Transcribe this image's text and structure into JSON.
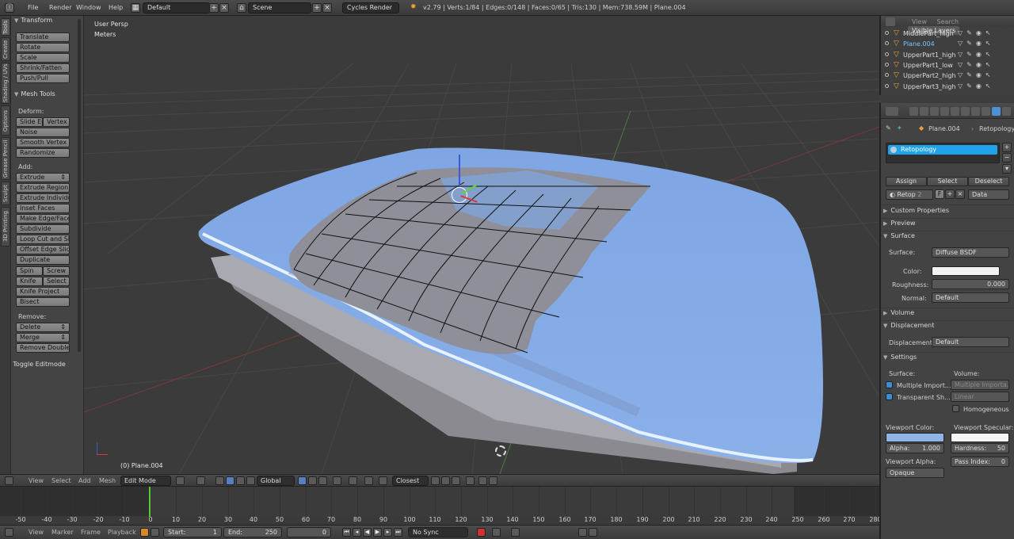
{
  "topbar": {
    "menus": [
      "File",
      "Render",
      "Window",
      "Help"
    ],
    "screen_layout": "Default",
    "scene": "Scene",
    "render_engine": "Cycles Render",
    "stats": "v2.79 | Verts:1/84 | Edges:0/148 | Faces:0/65 | Tris:130 | Mem:738.59M | Plane.004"
  },
  "vtabs": [
    "Tools",
    "Create",
    "Shading / UVs",
    "Options",
    "Grease Pencil",
    "Sculpt",
    "3D Printing"
  ],
  "toolshelf": {
    "transform_title": "Transform",
    "transform": [
      "Translate",
      "Rotate",
      "Scale",
      "Shrink/Fatten",
      "Push/Pull"
    ],
    "mesh_tools_title": "Mesh Tools",
    "deform_label": "Deform:",
    "slide_edge": "Slide Ed",
    "vertex": "Vertex",
    "deform": [
      "Noise",
      "Smooth Vertex",
      "Randomize"
    ],
    "add_label": "Add:",
    "extrude": "Extrude",
    "add": [
      "Extrude Region",
      "Extrude Individual",
      "Inset Faces",
      "Make Edge/Face",
      "Subdivide",
      "Loop Cut and Slide",
      "Offset Edge Slide",
      "Duplicate"
    ],
    "spin": "Spin",
    "screw": "Screw",
    "knife": "Knife",
    "select": "Select",
    "add2": [
      "Knife Project",
      "Bisect"
    ],
    "remove_label": "Remove:",
    "delete": "Delete",
    "merge": "Merge",
    "remove_doubles": "Remove Doubles",
    "toggle_editmode": "Toggle Editmode"
  },
  "viewport": {
    "persp": "User Persp",
    "units": "Meters",
    "object": "(0) Plane.004"
  },
  "vpheader": {
    "menus": [
      "View",
      "Select",
      "Add",
      "Mesh"
    ],
    "mode": "Edit Mode",
    "orientation": "Global",
    "snap": "Closest"
  },
  "timeline": {
    "ticks": [
      "-50",
      "-40",
      "-30",
      "-20",
      "-10",
      "0",
      "10",
      "20",
      "30",
      "40",
      "50",
      "60",
      "70",
      "80",
      "90",
      "100",
      "110",
      "120",
      "130",
      "140",
      "150",
      "160",
      "170",
      "180",
      "190",
      "200",
      "210",
      "220",
      "230",
      "240",
      "250",
      "260",
      "270",
      "280"
    ],
    "current_frame": 0
  },
  "tlheader": {
    "menus": [
      "View",
      "Marker",
      "Frame",
      "Playback"
    ],
    "start_label": "Start:",
    "start": "1",
    "end_label": "End:",
    "end": "250",
    "frame": "0",
    "sync": "No Sync"
  },
  "outliner": {
    "tabs": [
      "View",
      "Search",
      "Visible Layers"
    ],
    "items": [
      {
        "name": "MiddlePart_high",
        "active": false
      },
      {
        "name": "Plane.004",
        "active": true
      },
      {
        "name": "UpperPart1_high",
        "active": false
      },
      {
        "name": "UpperPart1_low",
        "active": false
      },
      {
        "name": "UpperPart2_high",
        "active": false
      },
      {
        "name": "UpperPart3_high",
        "active": false
      }
    ]
  },
  "props": {
    "breadcrumb_obj": "Plane.004",
    "breadcrumb_mat": "Retopology",
    "slot_name": "Retopology",
    "assign": "Assign",
    "select": "Select",
    "deselect": "Deselect",
    "mat_name": "Retop",
    "mat_users": "2",
    "f_label": "F",
    "data": "Data",
    "sections": {
      "custom_props": "Custom Properties",
      "preview": "Preview",
      "surface": "Surface",
      "volume": "Volume",
      "displacement": "Displacement",
      "settings": "Settings"
    },
    "surface_label": "Surface:",
    "surface_value": "Diffuse BSDF",
    "color_label": "Color:",
    "roughness_label": "Roughness:",
    "roughness_value": "0.000",
    "normal_label": "Normal:",
    "normal_value": "Default",
    "displacement_label": "Displacement:",
    "displacement_value": "Default",
    "settings_surface": "Surface:",
    "settings_volume": "Volume:",
    "multiple_importance": "Multiple Import...",
    "multiple_importance_vol": "Multiple Importa...",
    "transparent_shadow": "Transparent Sh...",
    "linear": "Linear",
    "homogeneous": "Homogeneous",
    "viewport_color_label": "Viewport Color:",
    "viewport_specular_label": "Viewport Specular:",
    "alpha_label": "Alpha:",
    "alpha_value": "1.000",
    "hardness_label": "Hardness:",
    "hardness_value": "50",
    "viewport_alpha_label": "Viewport Alpha:",
    "pass_index_label": "Pass Index:",
    "pass_index_value": "0",
    "viewport_alpha_value": "Opaque"
  },
  "colors": {
    "accent": "#4f8fd6",
    "slot_highlight": "#1fa3ea",
    "viewport_color": "#8fb4e6",
    "mesh_blue": "#7aa3de",
    "playhead": "#57c93a"
  }
}
